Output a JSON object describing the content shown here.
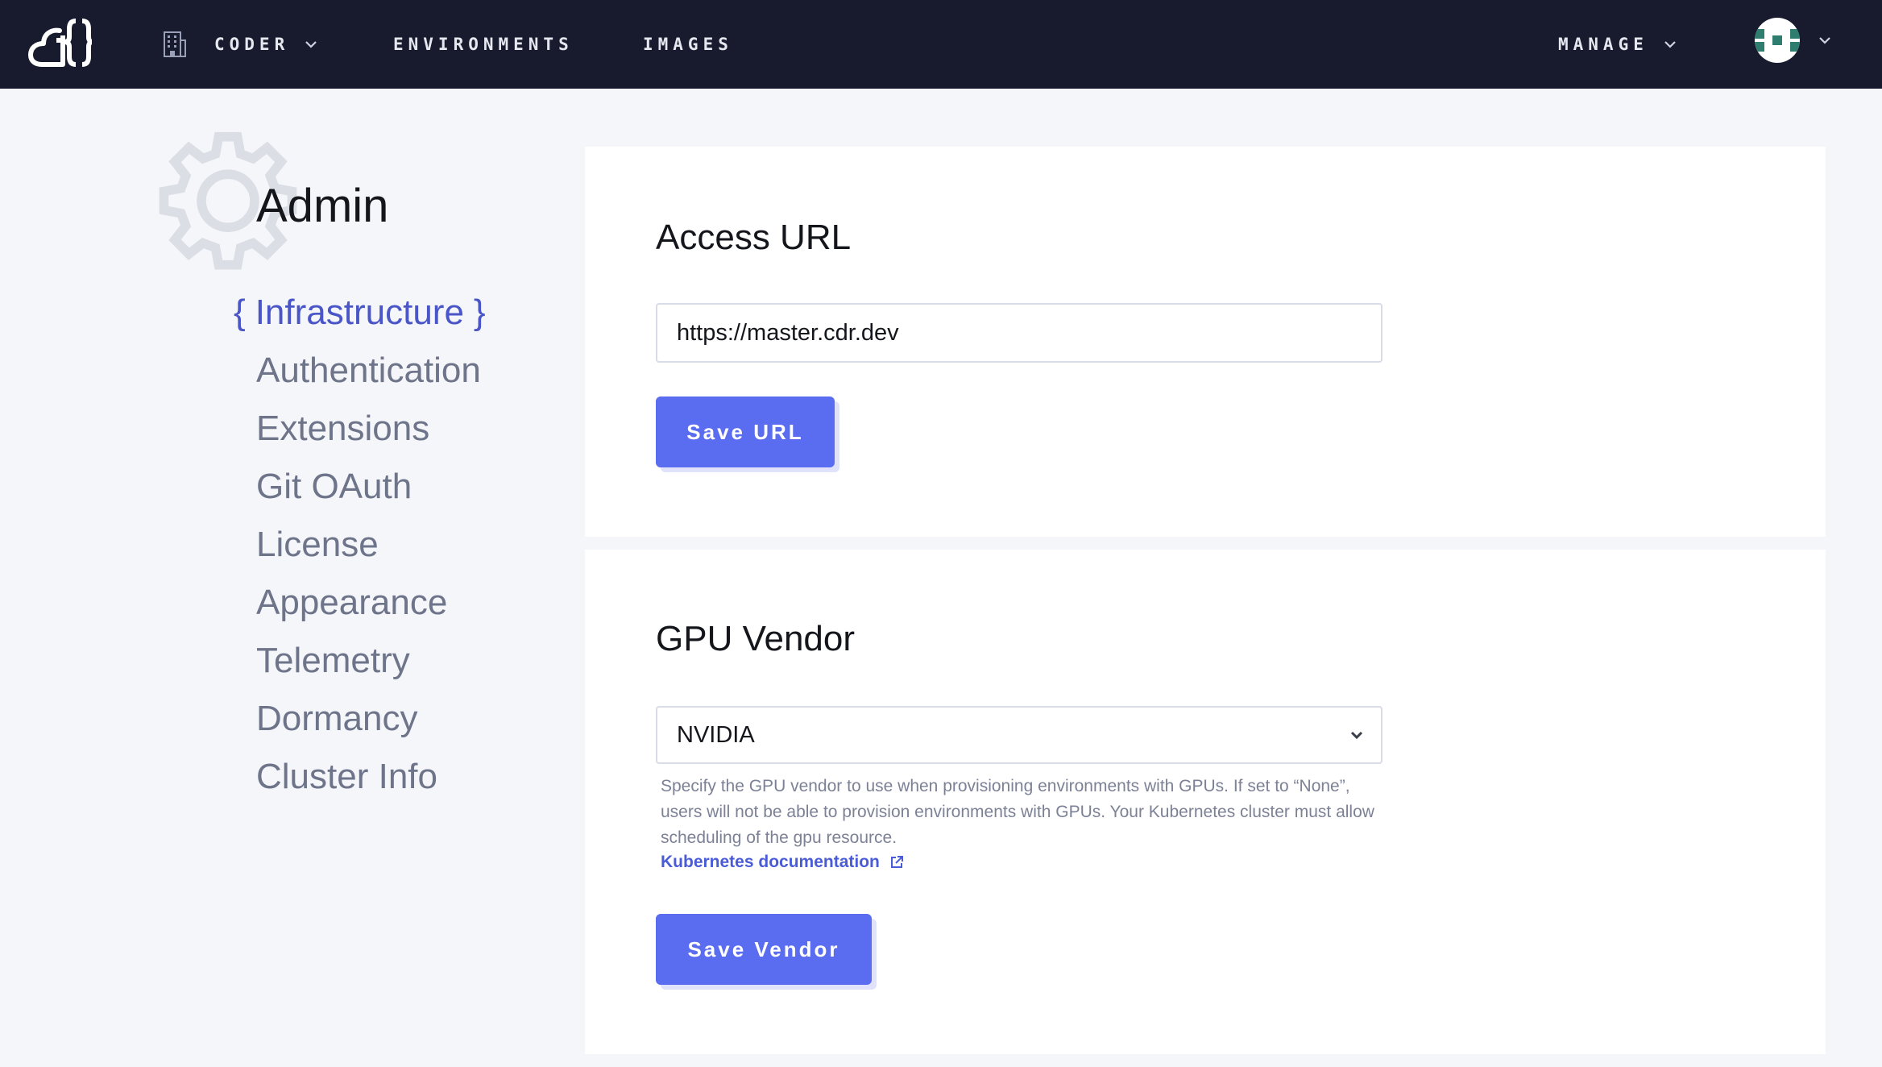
{
  "topbar": {
    "org_label": "CODER",
    "environments_label": "ENVIRONMENTS",
    "images_label": "IMAGES",
    "manage_label": "MANAGE"
  },
  "sidebar": {
    "title": "Admin",
    "active_open_brace": "{",
    "active_close_brace": "}",
    "items": [
      {
        "label": "Infrastructure",
        "active": true
      },
      {
        "label": "Authentication"
      },
      {
        "label": "Extensions"
      },
      {
        "label": "Git OAuth"
      },
      {
        "label": "License"
      },
      {
        "label": "Appearance"
      },
      {
        "label": "Telemetry"
      },
      {
        "label": "Dormancy"
      },
      {
        "label": "Cluster Info"
      }
    ]
  },
  "access_url": {
    "title": "Access URL",
    "value": "https://master.cdr.dev",
    "button": "Save URL"
  },
  "gpu_vendor": {
    "title": "GPU Vendor",
    "selected": "NVIDIA",
    "help": "Specify the GPU vendor to use when provisioning environments with GPUs. If set to “None”, users will not be able to provision environments with GPUs. Your Kubernetes cluster must allow scheduling of the gpu resource.",
    "link": "Kubernetes documentation",
    "button": "Save Vendor"
  },
  "colors": {
    "topbar": "#181a2e",
    "accent": "#5a6cf0",
    "active_nav": "#4a56c8",
    "background": "#f5f6fa"
  },
  "icons": [
    "coder-logo-icon",
    "building-icon",
    "chevron-down-icon",
    "avatar",
    "gear-icon",
    "external-link-icon"
  ]
}
